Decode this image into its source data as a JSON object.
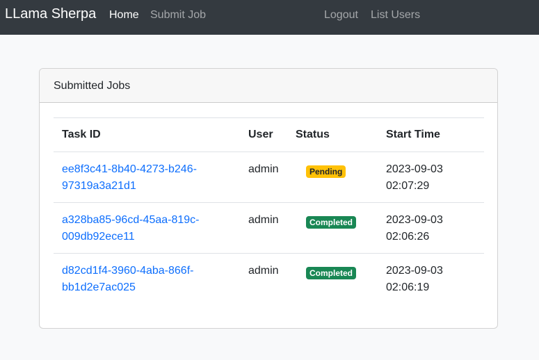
{
  "navbar": {
    "brand": "LLama Sherpa",
    "links": [
      {
        "label": "Home",
        "active": true
      },
      {
        "label": "Submit Job",
        "active": false
      },
      {
        "label": "Logout",
        "active": false
      },
      {
        "label": "List Users",
        "active": false
      }
    ]
  },
  "card": {
    "title": "Submitted Jobs",
    "columns": [
      "Task ID",
      "User",
      "Status",
      "Start Time"
    ],
    "rows": [
      {
        "task_id_1": "ee8f3c41-8b40-4273-b246-",
        "task_id_2": "97319a3a21d1",
        "user": "admin",
        "status": "Pending",
        "date": "2023-09-03",
        "time": "02:07:29"
      },
      {
        "task_id_1": "a328ba85-96cd-45aa-819c-",
        "task_id_2": "009db92ece11",
        "user": "admin",
        "status": "Completed",
        "date": "2023-09-03",
        "time": "02:06:26"
      },
      {
        "task_id_1": "d82cd1f4-3960-4aba-866f-",
        "task_id_2": "bb1d2e7ac025",
        "user": "admin",
        "status": "Completed",
        "date": "2023-09-03",
        "time": "02:06:19"
      }
    ]
  },
  "colors": {
    "navbar_bg": "#343a40",
    "link": "#0d6efd",
    "pending": "#ffc107",
    "completed": "#198754"
  }
}
